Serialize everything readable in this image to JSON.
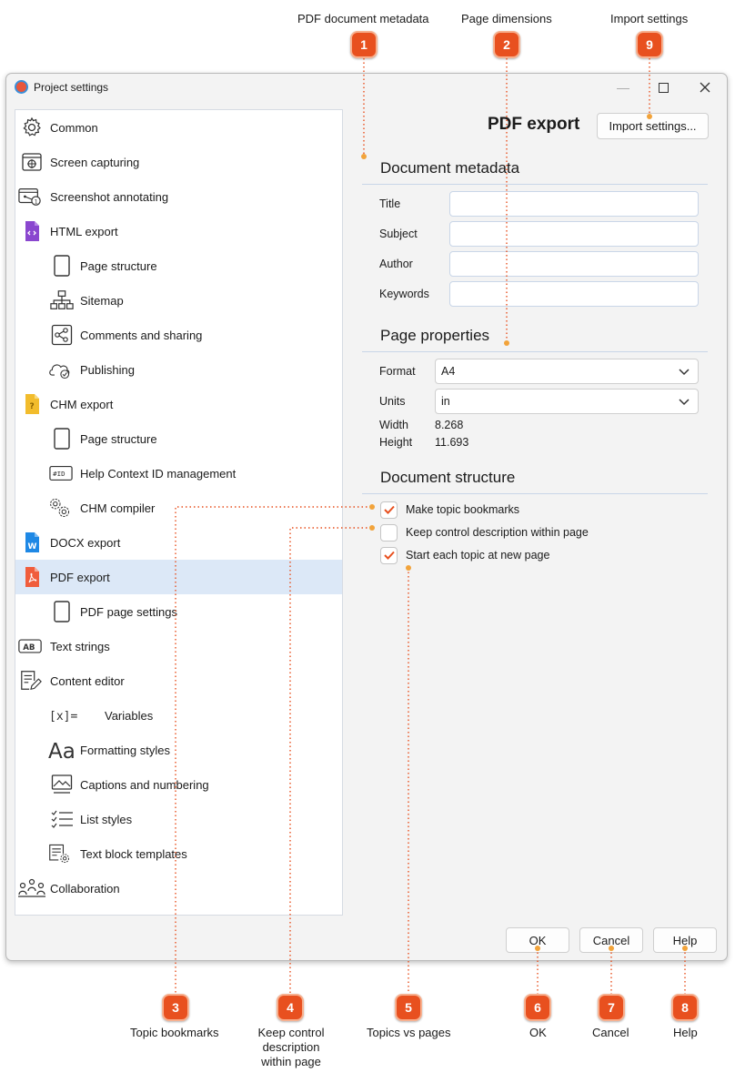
{
  "callouts": {
    "top": [
      {
        "num": "1",
        "caption": "PDF document metadata"
      },
      {
        "num": "2",
        "caption": "Page dimensions"
      },
      {
        "num": "9",
        "caption": "Import settings"
      }
    ],
    "bottom": [
      {
        "num": "3",
        "caption": "Topic bookmarks"
      },
      {
        "num": "4",
        "caption": "Keep control description within page"
      },
      {
        "num": "5",
        "caption": "Topics vs pages"
      },
      {
        "num": "6",
        "caption": "OK"
      },
      {
        "num": "7",
        "caption": "Cancel"
      },
      {
        "num": "8",
        "caption": "Help"
      }
    ],
    "accent_color": "#e8501f",
    "leader_color": "#e8501f"
  },
  "window": {
    "title": "Project settings",
    "controls": {
      "minimize": "—",
      "maximize": "☐",
      "close": "✕"
    }
  },
  "nav": {
    "items": [
      {
        "label": "Common",
        "icon": "gear-icon"
      },
      {
        "label": "Screen capturing",
        "icon": "screen-capture-icon"
      },
      {
        "label": "Screenshot annotating",
        "icon": "annotate-icon"
      },
      {
        "label": "HTML export",
        "icon": "html-file-icon"
      },
      {
        "label": "Page structure",
        "icon": "page-icon"
      },
      {
        "label": "Sitemap",
        "icon": "sitemap-icon"
      },
      {
        "label": "Comments and sharing",
        "icon": "share-icon"
      },
      {
        "label": "Publishing",
        "icon": "cloud-check-icon"
      },
      {
        "label": "CHM export",
        "icon": "chm-file-icon"
      },
      {
        "label": "Page structure",
        "icon": "page-icon"
      },
      {
        "label": "Help Context ID management",
        "icon": "id-icon"
      },
      {
        "label": "CHM compiler",
        "icon": "gears-icon"
      },
      {
        "label": "DOCX export",
        "icon": "docx-file-icon"
      },
      {
        "label": "PDF export",
        "icon": "pdf-file-icon"
      },
      {
        "label": "PDF page settings",
        "icon": "page-icon"
      },
      {
        "label": "Text strings",
        "icon": "text-strings-icon"
      },
      {
        "label": "Content editor",
        "icon": "content-editor-icon"
      },
      {
        "label": "Variables",
        "icon": "variables-icon"
      },
      {
        "label": "Formatting styles",
        "icon": "formatting-icon"
      },
      {
        "label": "Captions and numbering",
        "icon": "image-caption-icon"
      },
      {
        "label": "List styles",
        "icon": "list-icon"
      },
      {
        "label": "Text block templates",
        "icon": "text-block-icon"
      },
      {
        "label": "Collaboration",
        "icon": "collaboration-icon"
      }
    ],
    "selected": "PDF export"
  },
  "main": {
    "heading": "PDF export",
    "import_button": "Import settings...",
    "metadata": {
      "heading": "Document metadata",
      "fields": [
        {
          "label": "Title",
          "value": ""
        },
        {
          "label": "Subject",
          "value": ""
        },
        {
          "label": "Author",
          "value": ""
        },
        {
          "label": "Keywords",
          "value": ""
        }
      ]
    },
    "page_properties": {
      "heading": "Page properties",
      "format_label": "Format",
      "format_value": "A4",
      "units_label": "Units",
      "units_value": "in",
      "width_label": "Width",
      "width_value": "8.268",
      "height_label": "Height",
      "height_value": "11.693"
    },
    "structure": {
      "heading": "Document structure",
      "options": [
        {
          "label": "Make topic bookmarks",
          "checked": true
        },
        {
          "label": "Keep control description within page",
          "checked": false
        },
        {
          "label": "Start each topic at new page",
          "checked": true
        }
      ]
    }
  },
  "footer": {
    "ok": "OK",
    "cancel": "Cancel",
    "help": "Help"
  }
}
